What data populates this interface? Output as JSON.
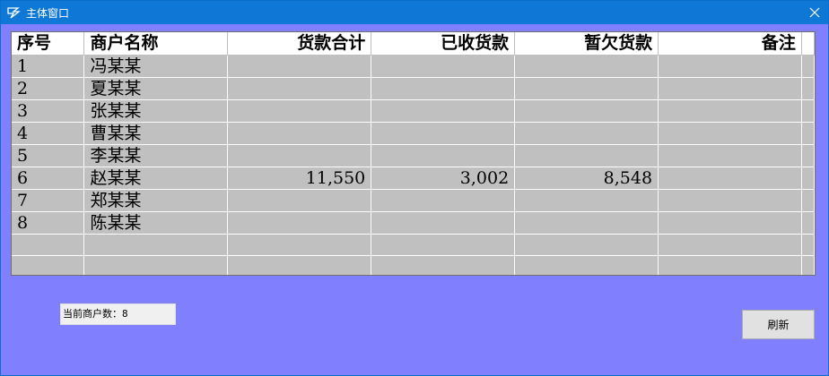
{
  "window": {
    "title": "主体窗口",
    "app_icon": "app-logo-icon",
    "close_icon": "close-icon"
  },
  "table": {
    "columns": [
      {
        "key": "no",
        "label": "序号",
        "align": "left"
      },
      {
        "key": "name",
        "label": "商户名称",
        "align": "left"
      },
      {
        "key": "total",
        "label": "货款合计",
        "align": "right"
      },
      {
        "key": "received",
        "label": "已收货款",
        "align": "right"
      },
      {
        "key": "owed",
        "label": "暂欠货款",
        "align": "right"
      },
      {
        "key": "note",
        "label": "备注",
        "align": "right"
      }
    ],
    "rows": [
      {
        "no": "1",
        "name": "冯某某",
        "total": "",
        "received": "",
        "owed": "",
        "note": ""
      },
      {
        "no": "2",
        "name": "夏某某",
        "total": "",
        "received": "",
        "owed": "",
        "note": ""
      },
      {
        "no": "3",
        "name": "张某某",
        "total": "",
        "received": "",
        "owed": "",
        "note": ""
      },
      {
        "no": "4",
        "name": "曹某某",
        "total": "",
        "received": "",
        "owed": "",
        "note": ""
      },
      {
        "no": "5",
        "name": "李某某",
        "total": "",
        "received": "",
        "owed": "",
        "note": ""
      },
      {
        "no": "6",
        "name": "赵某某",
        "total": "11,550",
        "received": "3,002",
        "owed": "8,548",
        "note": ""
      },
      {
        "no": "7",
        "name": "郑某某",
        "total": "",
        "received": "",
        "owed": "",
        "note": ""
      },
      {
        "no": "8",
        "name": "陈某某",
        "total": "",
        "received": "",
        "owed": "",
        "note": ""
      },
      {
        "no": "",
        "name": "",
        "total": "",
        "received": "",
        "owed": "",
        "note": ""
      },
      {
        "no": "",
        "name": "",
        "total": "",
        "received": "",
        "owed": "",
        "note": ""
      }
    ]
  },
  "status": {
    "text": "当前商户数：8"
  },
  "buttons": {
    "refresh_label": "刷新"
  },
  "colors": {
    "titlebar": "#0f78d7",
    "window_bg": "#8080ff",
    "grid_bg": "#c0c0c0"
  }
}
